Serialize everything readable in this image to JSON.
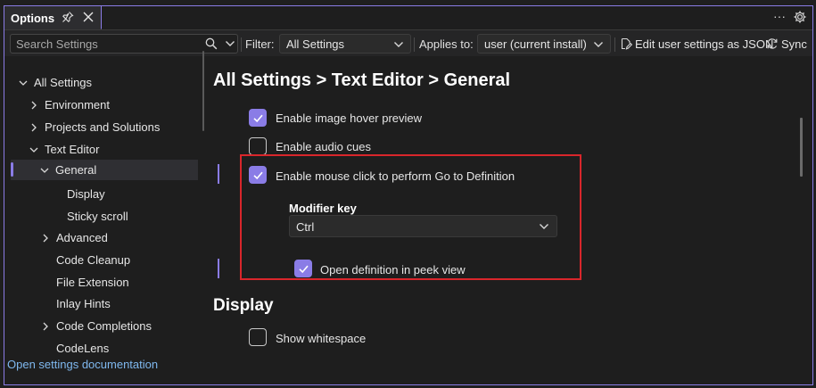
{
  "window": {
    "tab_title": "Options",
    "more_icon": "more-icon",
    "settings_icon": "gear-icon"
  },
  "toolbar": {
    "search_placeholder": "Search Settings",
    "filter_label": "Filter:",
    "filter_value": "All Settings",
    "applies_label": "Applies to:",
    "applies_value": "user (current install)",
    "edit_json_label": "Edit user settings as JSON",
    "sync_label": "Sync"
  },
  "sidebar": {
    "items": [
      {
        "label": "All Settings"
      },
      {
        "label": "Environment"
      },
      {
        "label": "Projects and Solutions"
      },
      {
        "label": "Text Editor"
      },
      {
        "label": "General"
      },
      {
        "label": "Display"
      },
      {
        "label": "Sticky scroll"
      },
      {
        "label": "Advanced"
      },
      {
        "label": "Code Cleanup"
      },
      {
        "label": "File Extension"
      },
      {
        "label": "Inlay Hints"
      },
      {
        "label": "Code Completions"
      },
      {
        "label": "CodeLens"
      }
    ],
    "footer_link": "Open settings documentation"
  },
  "main": {
    "breadcrumb_heading": "All Settings > Text Editor > General",
    "options": [
      {
        "label": "Enable image hover preview",
        "checked": true
      },
      {
        "label": "Enable audio cues",
        "checked": false
      },
      {
        "label": "Enable mouse click to perform Go to Definition",
        "checked": true
      }
    ],
    "modifier": {
      "title": "Modifier key",
      "value": "Ctrl"
    },
    "peek_option": {
      "label": "Open definition in peek view",
      "checked": true
    },
    "display_section": {
      "title": "Display",
      "options": [
        {
          "label": "Show whitespace",
          "checked": false
        }
      ]
    }
  },
  "colors": {
    "accent": "#8a7ce6",
    "highlight_border": "#d9262b",
    "link": "#7fb8ef",
    "background": "#1e1e1e"
  }
}
